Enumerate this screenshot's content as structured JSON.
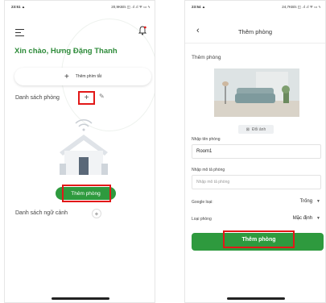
{
  "left_screen": {
    "status": {
      "time": "23:51 ▲",
      "icons": "20,9KB/s ◫ .ıl .ıl ᯤ ▭ ϟ"
    },
    "greeting": "Xin chào, Hưng Đặng Thanh",
    "add_shortcut_label": "Thêm phím tắt",
    "rooms_label": "Danh sách phòng",
    "rooms_add": "+",
    "empty_add_room_button": "Thêm phòng",
    "scenes_label": "Danh sách ngữ cảnh",
    "scenes_add": "+",
    "accent_color": "#2e9a3e",
    "highlight_color": "#e21818"
  },
  "right_screen": {
    "status": {
      "time": "23:54 ▲",
      "icons": "24,7KB/s ◫ .ıl .ıl ᯤ ▭ ϟ"
    },
    "back_icon": "‹",
    "title": "Thêm phòng",
    "section_title": "Thêm phòng",
    "change_image_button": "Đổi ảnh",
    "name_label": "Nhập tên phòng",
    "name_value": "Room1",
    "desc_label": "Nhập mô tả phòng",
    "desc_placeholder": "Nhập mô tả phòng",
    "google_room_label": "Google loại:",
    "google_room_value": "Trống",
    "room_type_label": "Loại phòng",
    "room_type_value": "Mặc định",
    "submit_button": "Thêm phòng"
  }
}
